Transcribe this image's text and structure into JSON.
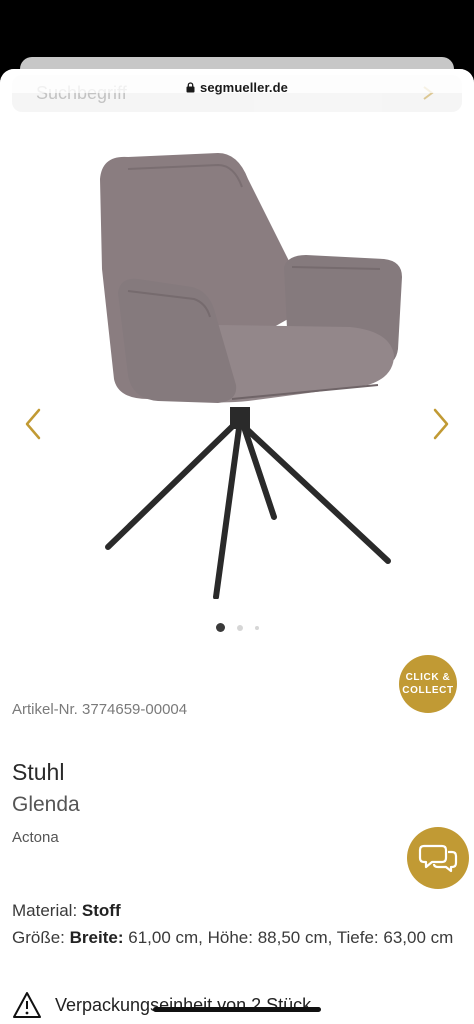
{
  "browser": {
    "url": "segmueller.de",
    "search_placeholder": "Suchbegriff"
  },
  "gallery": {
    "image_alt": "Stuhl Glenda",
    "dots": 3,
    "active_dot": 1,
    "chair_color": "#8a7d80",
    "leg_color": "#2a2a2a"
  },
  "badge": {
    "line1": "CLICK &",
    "line2": "COLLECT",
    "color": "#c19a34"
  },
  "product": {
    "article_nr": "Artikel-Nr. 3774659-00004",
    "title": "Stuhl",
    "name": "Glenda",
    "brand": "Actona",
    "material_label": "Material:",
    "material_value": "Stoff",
    "size_label": "Größe:",
    "size_value": "Breite: 61,00 cm, Höhe: 88,50 cm, Tiefe: 63,00 cm",
    "notice": "Verpackungseinheit von 2 Stück"
  },
  "colors": {
    "accent": "#c19a34"
  }
}
